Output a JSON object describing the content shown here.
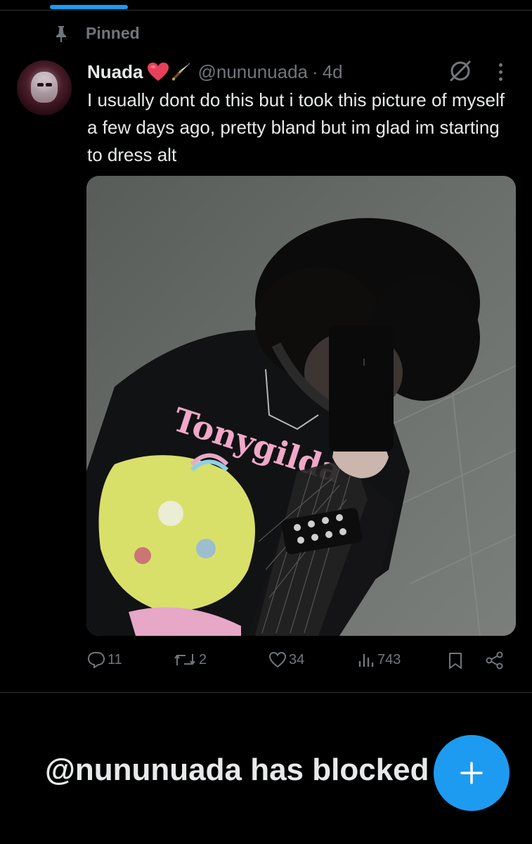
{
  "pinned": {
    "label": "Pinned"
  },
  "tweet": {
    "display_name": "Nuada",
    "name_emoji": [
      "red-heart-icon",
      "dagger-icon"
    ],
    "handle": "@nununuada",
    "separator": "·",
    "time": "4d",
    "text": "I usually dont do this but i took this picture of myself a few days ago, pretty bland but im glad im starting to dress alt",
    "media": {
      "shirt_text": "Tonygilda"
    },
    "actions": {
      "replies": "11",
      "reposts": "2",
      "likes": "34",
      "views": "743"
    }
  },
  "blocked_message": "@nununuada has blocked you",
  "colors": {
    "accent": "#1d9bf0",
    "muted": "#71767b",
    "text": "#e7e9ea",
    "background": "#000000"
  }
}
